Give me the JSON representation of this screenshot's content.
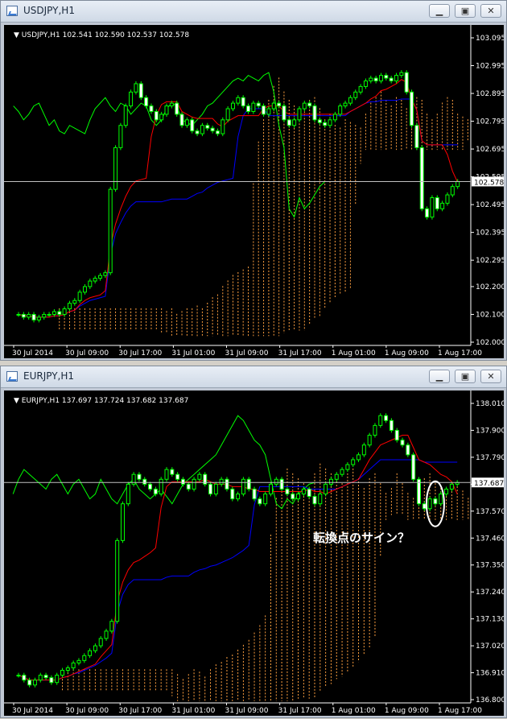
{
  "windows": [
    {
      "title": "USDJPY,H1",
      "header": "USDJPY,H1  102.541 102.590 102.537 102.578",
      "price_labels": [
        "103.095",
        "102.995",
        "102.895",
        "102.795",
        "102.695",
        "102.595",
        "102.495",
        "102.395",
        "102.295",
        "102.200",
        "102.100",
        "102.000"
      ],
      "current_price": "102.578",
      "time_labels": [
        "30 Jul 2014",
        "30 Jul 09:00",
        "30 Jul 17:00",
        "31 Jul 01:00",
        "31 Jul 09:00",
        "31 Jul 17:00",
        "1 Aug 01:00",
        "1 Aug 09:00",
        "1 Aug 17:00"
      ]
    },
    {
      "title": "EURJPY,H1",
      "header": "EURJPY,H1  137.697 137.724 137.682 137.687",
      "price_labels": [
        "138.010",
        "137.900",
        "137.790",
        "137.680",
        "137.570",
        "137.460",
        "137.350",
        "137.240",
        "137.130",
        "137.020",
        "136.910",
        "136.800"
      ],
      "current_price": "137.687",
      "time_labels": [
        "30 Jul 2014",
        "30 Jul 09:00",
        "30 Jul 17:00",
        "31 Jul 01:00",
        "31 Jul 09:00",
        "31 Jul 17:00",
        "1 Aug 01:00",
        "1 Aug 09:00",
        "1 Aug 17:00"
      ],
      "annotation": "転換点のサイン？"
    }
  ],
  "colors": {
    "bg": "#000000",
    "bull": "#00ff00",
    "bear": "#ffffff",
    "tenkan": "#ff0000",
    "kijun": "#0000ff",
    "chikou": "#00ff00",
    "cloud": "#ffa040",
    "price_line": "#c0c0c0"
  },
  "chart_data": [
    {
      "type": "candlestick",
      "title": "USDJPY,H1",
      "ylim": [
        102.0,
        103.095
      ],
      "ohlc": [
        102.541,
        102.59,
        102.537,
        102.578
      ],
      "y_ticks": [
        103.095,
        102.995,
        102.895,
        102.795,
        102.695,
        102.595,
        102.495,
        102.395,
        102.295,
        102.2,
        102.1,
        102.0
      ],
      "x_ticks": [
        "30 Jul 2014",
        "30 Jul 09:00",
        "30 Jul 17:00",
        "31 Jul 01:00",
        "31 Jul 09:00",
        "31 Jul 17:00",
        "1 Aug 01:00",
        "1 Aug 09:00",
        "1 Aug 17:00"
      ],
      "close": [
        102.1,
        102.09,
        102.1,
        102.08,
        102.09,
        102.1,
        102.1,
        102.11,
        102.1,
        102.12,
        102.14,
        102.15,
        102.18,
        102.2,
        102.22,
        102.23,
        102.24,
        102.25,
        102.55,
        102.7,
        102.78,
        102.85,
        102.9,
        102.93,
        102.88,
        102.85,
        102.83,
        102.8,
        102.82,
        102.85,
        102.86,
        102.82,
        102.78,
        102.8,
        102.76,
        102.75,
        102.78,
        102.77,
        102.76,
        102.75,
        102.8,
        102.84,
        102.86,
        102.88,
        102.85,
        102.83,
        102.86,
        102.85,
        102.82,
        102.84,
        102.86,
        102.85,
        102.8,
        102.78,
        102.8,
        102.84,
        102.86,
        102.85,
        102.8,
        102.79,
        102.78,
        102.8,
        102.82,
        102.85,
        102.86,
        102.88,
        102.9,
        102.92,
        102.94,
        102.95,
        102.94,
        102.96,
        102.95,
        102.94,
        102.96,
        102.97,
        102.9,
        102.78,
        102.7,
        102.48,
        102.45,
        102.52,
        102.48,
        102.5,
        102.53,
        102.56,
        102.578
      ]
    },
    {
      "type": "candlestick",
      "title": "EURJPY,H1",
      "ylim": [
        136.8,
        138.01
      ],
      "ohlc": [
        137.697,
        137.724,
        137.682,
        137.687
      ],
      "y_ticks": [
        138.01,
        137.9,
        137.79,
        137.68,
        137.57,
        137.46,
        137.35,
        137.24,
        137.13,
        137.02,
        136.91,
        136.8
      ],
      "x_ticks": [
        "30 Jul 2014",
        "30 Jul 09:00",
        "30 Jul 17:00",
        "31 Jul 01:00",
        "31 Jul 09:00",
        "31 Jul 17:00",
        "1 Aug 01:00",
        "1 Aug 09:00",
        "1 Aug 17:00"
      ],
      "close": [
        136.9,
        136.88,
        136.86,
        136.88,
        136.9,
        136.89,
        136.87,
        136.9,
        136.92,
        136.93,
        136.95,
        136.96,
        136.98,
        137.0,
        137.02,
        137.05,
        137.08,
        137.12,
        137.45,
        137.6,
        137.68,
        137.72,
        137.7,
        137.68,
        137.66,
        137.64,
        137.7,
        137.74,
        137.72,
        137.7,
        137.68,
        137.66,
        137.7,
        137.72,
        137.68,
        137.64,
        137.68,
        137.7,
        137.66,
        137.62,
        137.64,
        137.7,
        137.66,
        137.62,
        137.6,
        137.64,
        137.68,
        137.7,
        137.66,
        137.64,
        137.62,
        137.64,
        137.66,
        137.63,
        137.6,
        137.64,
        137.68,
        137.7,
        137.72,
        137.74,
        137.76,
        137.78,
        137.8,
        137.84,
        137.88,
        137.92,
        137.96,
        137.94,
        137.9,
        137.86,
        137.84,
        137.8,
        137.7,
        137.6,
        137.58,
        137.62,
        137.6,
        137.64,
        137.66,
        137.68,
        137.687
      ]
    }
  ]
}
